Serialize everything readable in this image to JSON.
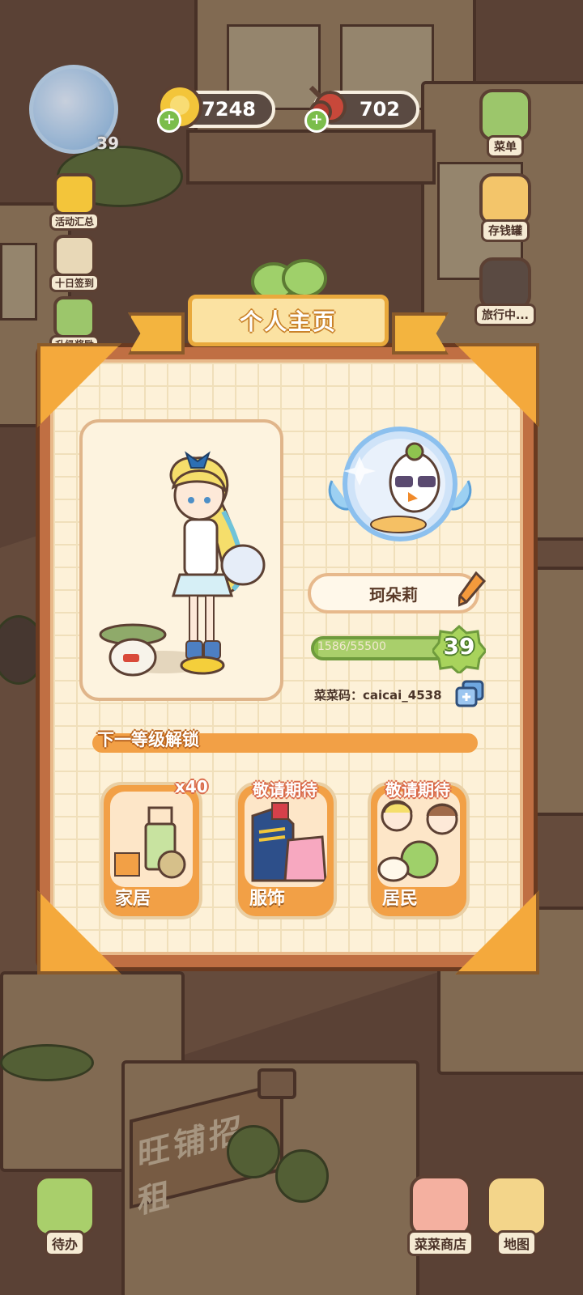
{
  "hud": {
    "coins": "7248",
    "food": "702",
    "player_level": "39"
  },
  "left_menu": [
    {
      "label": "活动汇总",
      "icon": "event-icon"
    },
    {
      "label": "十日签到",
      "icon": "checkin-icon"
    },
    {
      "label": "升级奖励",
      "icon": "levelup-reward-icon"
    }
  ],
  "right_menu": [
    {
      "label": "菜单",
      "icon": "menu-icon"
    },
    {
      "label": "存钱罐",
      "icon": "piggy-bank-icon"
    },
    {
      "label": "旅行中...",
      "icon": "camera-icon"
    }
  ],
  "dialog": {
    "title": "个人主页",
    "player_name": "珂朵莉",
    "exp_current": 1586,
    "exp_max": 55500,
    "exp_text": "1586/55500",
    "level": "39",
    "code_text": "菜菜码：caicai_4538",
    "unlock_title": "下一等级解锁",
    "cards": [
      {
        "label": "家居",
        "tag": "x40"
      },
      {
        "label": "服饰",
        "tag": "敬请期待"
      },
      {
        "label": "居民",
        "tag": "敬请期待"
      }
    ]
  },
  "background": {
    "shop_sign": "旺铺招租"
  },
  "bottom_menu": [
    {
      "label": "待办",
      "icon": "todo-icon"
    },
    {
      "label": "菜菜商店",
      "icon": "shop-icon"
    },
    {
      "label": "地图",
      "icon": "map-icon"
    }
  ],
  "colors": {
    "panel_orange": "#c06f43",
    "paper": "#fdf1d8",
    "accent_yellow": "#f4a93c",
    "exp_green": "#8bbd49"
  }
}
